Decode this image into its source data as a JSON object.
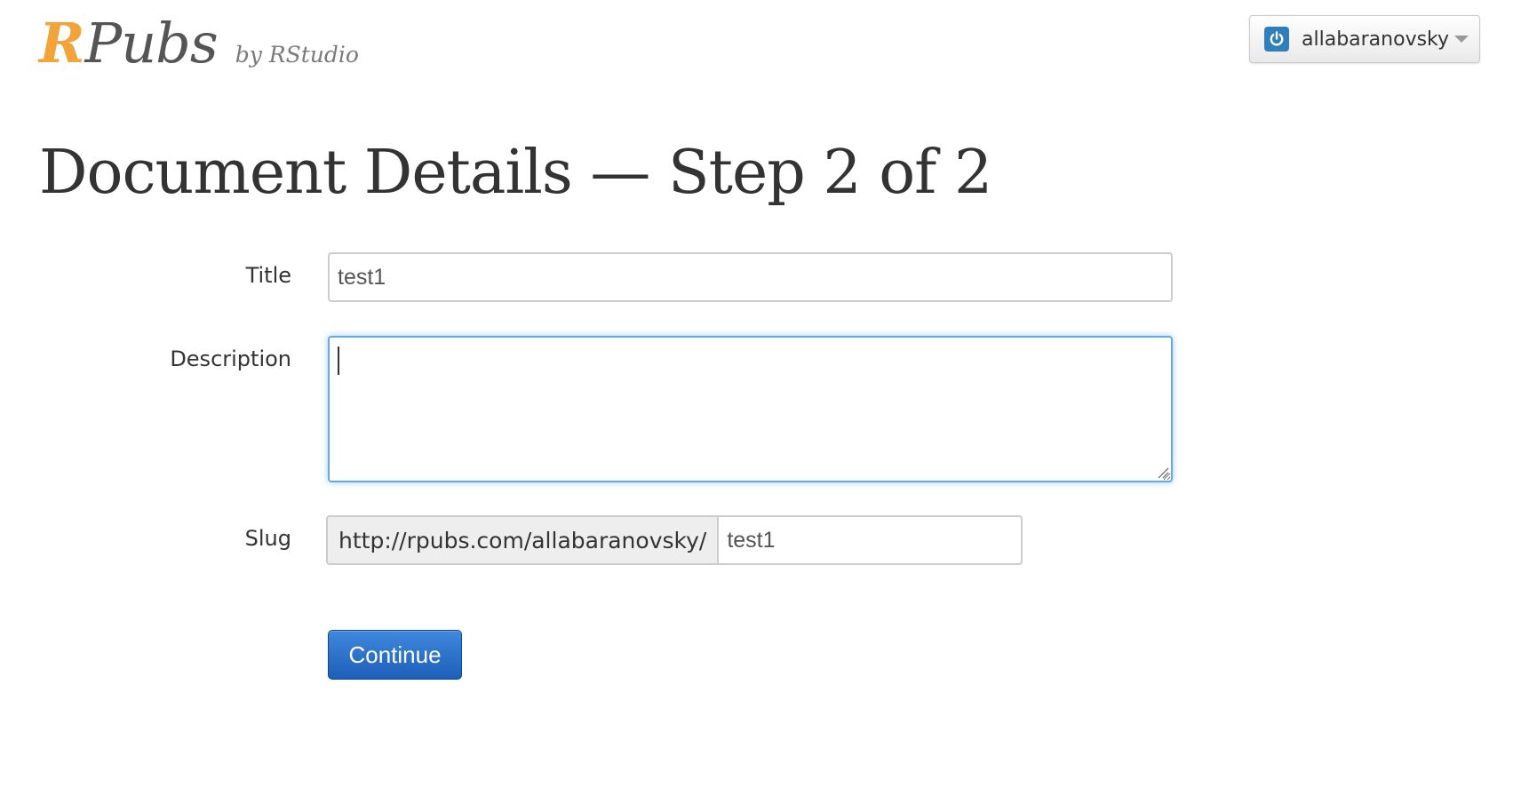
{
  "header": {
    "logo_r": "R",
    "logo_pubs": "Pubs",
    "logo_by": "by RStudio",
    "user_menu": {
      "username": "allabaranovsky",
      "icon": "power-icon",
      "accent_color": "#2f7fbd"
    }
  },
  "page": {
    "title": "Document Details — Step 2 of 2"
  },
  "form": {
    "title_label": "Title",
    "title_value": "test1",
    "description_label": "Description",
    "description_value": "",
    "slug_label": "Slug",
    "slug_prefix": "http://rpubs.com/allabaranovsky/",
    "slug_value": "test1",
    "continue_label": "Continue"
  },
  "colors": {
    "brand_orange": "#f2a33a",
    "primary_button": "#1d5fba",
    "focus_border": "#6aa7ea"
  }
}
